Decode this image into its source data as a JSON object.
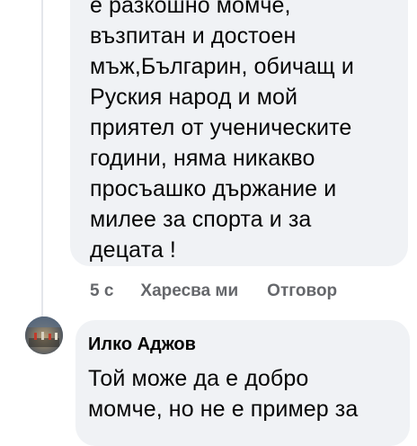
{
  "comment_1": {
    "text": "е разкошно момче,\nвъзпитан и достоен\nмъж,Българин, обичащ и\nРуския народ и мой\nприятел от ученическите\nгодини, няма никакво\nпросъашко държание и\nмилее за спорта и за\nдецата !",
    "time": "5 с",
    "like_label": "Харесва ми",
    "reply_label": "Отговор"
  },
  "comment_2": {
    "author": "Илко Аджов",
    "text": "Той може да е добро\nмомче, но не е пример за"
  },
  "colors": {
    "bubble": "#f0f2f5",
    "meta_text": "#65676b",
    "thread_line": "#e4e6eb"
  }
}
